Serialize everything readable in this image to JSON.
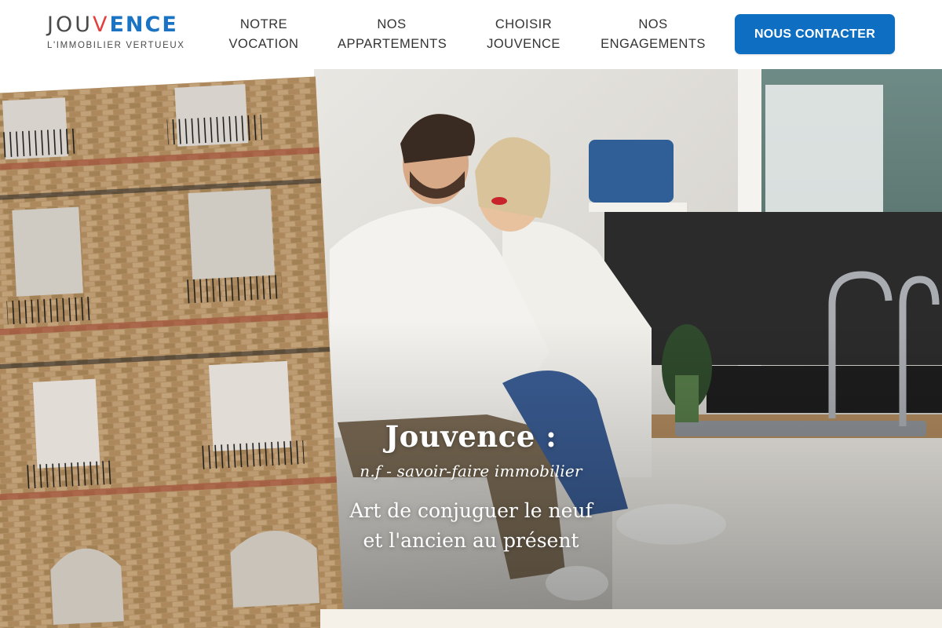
{
  "brand": {
    "name_part1": "JOU",
    "name_v": "V",
    "name_part2": "ENCE",
    "tagline": "L'IMMOBILIER VERTUEUX"
  },
  "nav": {
    "items": [
      {
        "line1": "NOTRE",
        "line2": "VOCATION"
      },
      {
        "line1": "NOS",
        "line2": "APPARTEMENTS"
      },
      {
        "line1": "CHOISIR",
        "line2": "JOUVENCE"
      },
      {
        "line1": "NOS",
        "line2": "ENGAGEMENTS"
      }
    ],
    "cta_label": "NOUS CONTACTER"
  },
  "hero": {
    "title": "Jouvence :",
    "subtitle": "n.f - savoir-faire immobilier",
    "line1": "Art de conjuguer le neuf",
    "line2": "et l'ancien au présent"
  },
  "colors": {
    "accent_blue": "#0e6fc2",
    "logo_red": "#e2403f",
    "text_dark": "#333333",
    "cream": "#f6f1e8"
  }
}
